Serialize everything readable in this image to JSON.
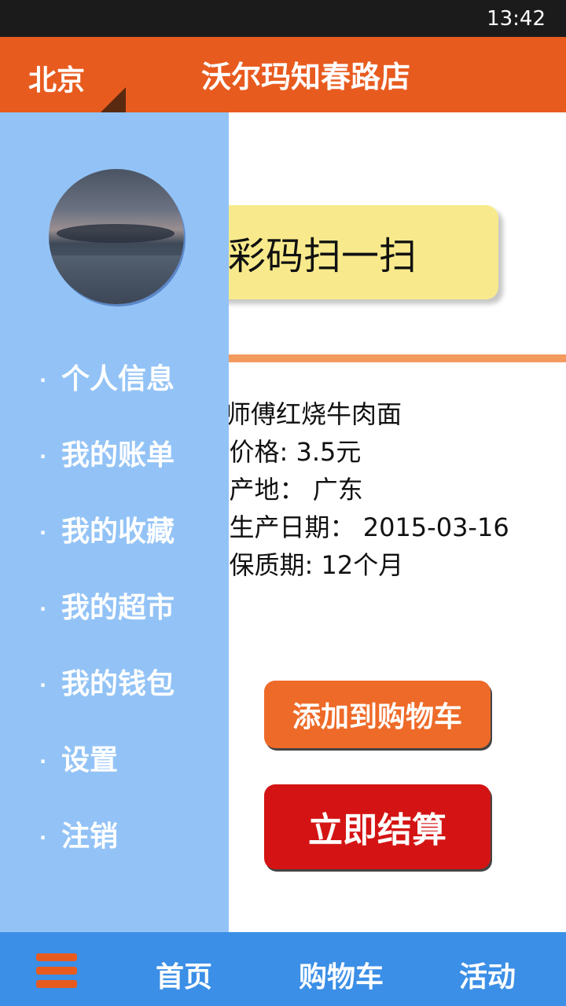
{
  "status_bar": {
    "time": "13:42"
  },
  "header": {
    "city": "北京",
    "store": "沃尔玛知春路店"
  },
  "scan": {
    "label": "彩码扫一扫"
  },
  "product": {
    "name": "康师傅红烧牛肉面",
    "price": "-价格: 3.5元",
    "origin": "-产地： 广东",
    "production_date": "-生产日期： 2015-03-16",
    "shelf_life": "-保质期:  12个月"
  },
  "actions": {
    "add_to_cart": "添加到购物车",
    "checkout": "立即结算"
  },
  "drawer": {
    "items": [
      {
        "label": "个人信息"
      },
      {
        "label": "我的账单"
      },
      {
        "label": "我的收藏"
      },
      {
        "label": "我的超市"
      },
      {
        "label": "我的钱包"
      },
      {
        "label": "设置"
      },
      {
        "label": "注销"
      }
    ],
    "bullet": "·"
  },
  "bottom_nav": {
    "home": "首页",
    "cart": "购物车",
    "activity": "活动"
  },
  "colors": {
    "primary": "#e85b1f",
    "drawer": "#93c3f6",
    "bottom_bar": "#3b8fe6",
    "checkout": "#d41414"
  }
}
